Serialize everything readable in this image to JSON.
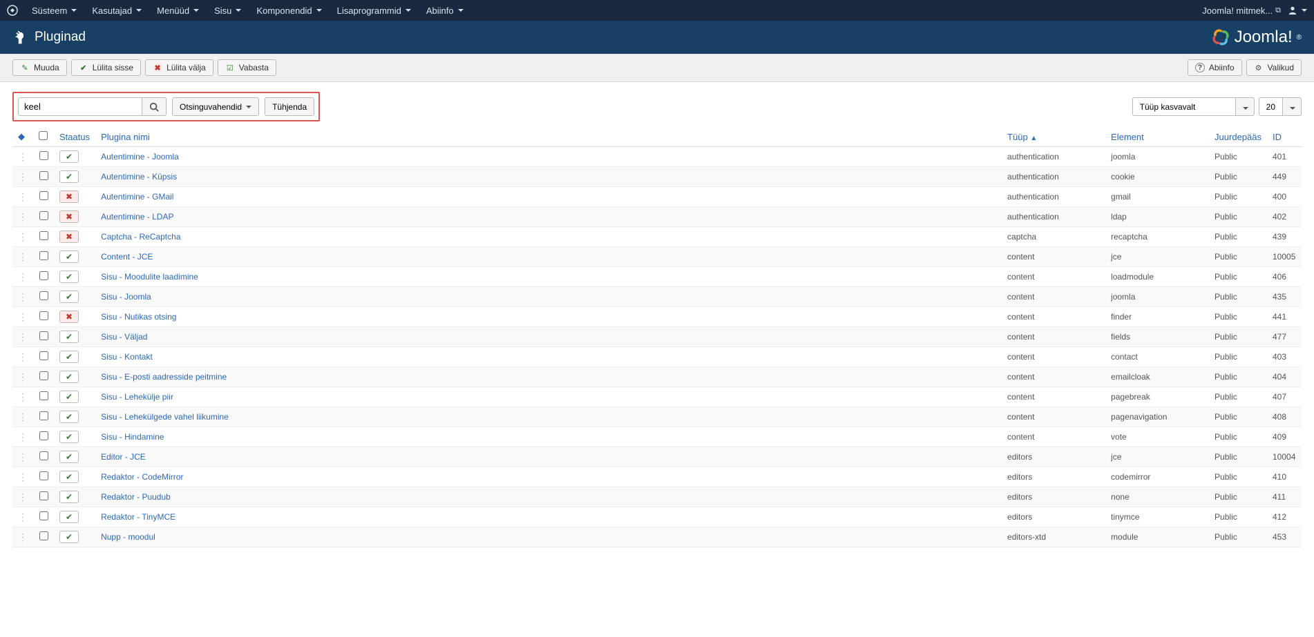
{
  "topnav": {
    "menu": [
      "Süsteem",
      "Kasutajad",
      "Menüüd",
      "Sisu",
      "Komponendid",
      "Lisaprogrammid",
      "Abiinfo"
    ],
    "site_link": "Joomla! mitmek..."
  },
  "header": {
    "title": "Pluginad",
    "logo": "Joomla!"
  },
  "toolbar": {
    "edit": "Muuda",
    "enable": "Lülita sisse",
    "disable": "Lülita välja",
    "checkin": "Vabasta",
    "help": "Abiinfo",
    "options": "Valikud"
  },
  "search": {
    "value": "keel",
    "tools": "Otsinguvahendid",
    "clear": "Tühjenda",
    "sort": "Tüüp kasvavalt",
    "limit": "20"
  },
  "table": {
    "headers": {
      "status": "Staatus",
      "name": "Plugina nimi",
      "type": "Tüüp",
      "element": "Element",
      "access": "Juurdepääs",
      "id": "ID"
    },
    "rows": [
      {
        "enabled": true,
        "name": "Autentimine - Joomla",
        "type": "authentication",
        "element": "joomla",
        "access": "Public",
        "id": "401"
      },
      {
        "enabled": true,
        "name": "Autentimine - Küpsis",
        "type": "authentication",
        "element": "cookie",
        "access": "Public",
        "id": "449"
      },
      {
        "enabled": false,
        "name": "Autentimine - GMail",
        "type": "authentication",
        "element": "gmail",
        "access": "Public",
        "id": "400"
      },
      {
        "enabled": false,
        "name": "Autentimine - LDAP",
        "type": "authentication",
        "element": "ldap",
        "access": "Public",
        "id": "402"
      },
      {
        "enabled": false,
        "name": "Captcha - ReCaptcha",
        "type": "captcha",
        "element": "recaptcha",
        "access": "Public",
        "id": "439"
      },
      {
        "enabled": true,
        "name": "Content - JCE",
        "type": "content",
        "element": "jce",
        "access": "Public",
        "id": "10005"
      },
      {
        "enabled": true,
        "name": "Sisu - Moodulite laadimine",
        "type": "content",
        "element": "loadmodule",
        "access": "Public",
        "id": "406"
      },
      {
        "enabled": true,
        "name": "Sisu - Joomla",
        "type": "content",
        "element": "joomla",
        "access": "Public",
        "id": "435"
      },
      {
        "enabled": false,
        "name": "Sisu - Nutikas otsing",
        "type": "content",
        "element": "finder",
        "access": "Public",
        "id": "441"
      },
      {
        "enabled": true,
        "name": "Sisu - Väljad",
        "type": "content",
        "element": "fields",
        "access": "Public",
        "id": "477"
      },
      {
        "enabled": true,
        "name": "Sisu - Kontakt",
        "type": "content",
        "element": "contact",
        "access": "Public",
        "id": "403"
      },
      {
        "enabled": true,
        "name": "Sisu - E-posti aadresside peitmine",
        "type": "content",
        "element": "emailcloak",
        "access": "Public",
        "id": "404"
      },
      {
        "enabled": true,
        "name": "Sisu - Lehekülje piir",
        "type": "content",
        "element": "pagebreak",
        "access": "Public",
        "id": "407"
      },
      {
        "enabled": true,
        "name": "Sisu - Lehekülgede vahel liikumine",
        "type": "content",
        "element": "pagenavigation",
        "access": "Public",
        "id": "408"
      },
      {
        "enabled": true,
        "name": "Sisu - Hindamine",
        "type": "content",
        "element": "vote",
        "access": "Public",
        "id": "409"
      },
      {
        "enabled": true,
        "name": "Editor - JCE",
        "type": "editors",
        "element": "jce",
        "access": "Public",
        "id": "10004"
      },
      {
        "enabled": true,
        "name": "Redaktor - CodeMirror",
        "type": "editors",
        "element": "codemirror",
        "access": "Public",
        "id": "410"
      },
      {
        "enabled": true,
        "name": "Redaktor - Puudub",
        "type": "editors",
        "element": "none",
        "access": "Public",
        "id": "411"
      },
      {
        "enabled": true,
        "name": "Redaktor - TinyMCE",
        "type": "editors",
        "element": "tinymce",
        "access": "Public",
        "id": "412"
      },
      {
        "enabled": true,
        "name": "Nupp - moodul",
        "type": "editors-xtd",
        "element": "module",
        "access": "Public",
        "id": "453"
      }
    ]
  }
}
